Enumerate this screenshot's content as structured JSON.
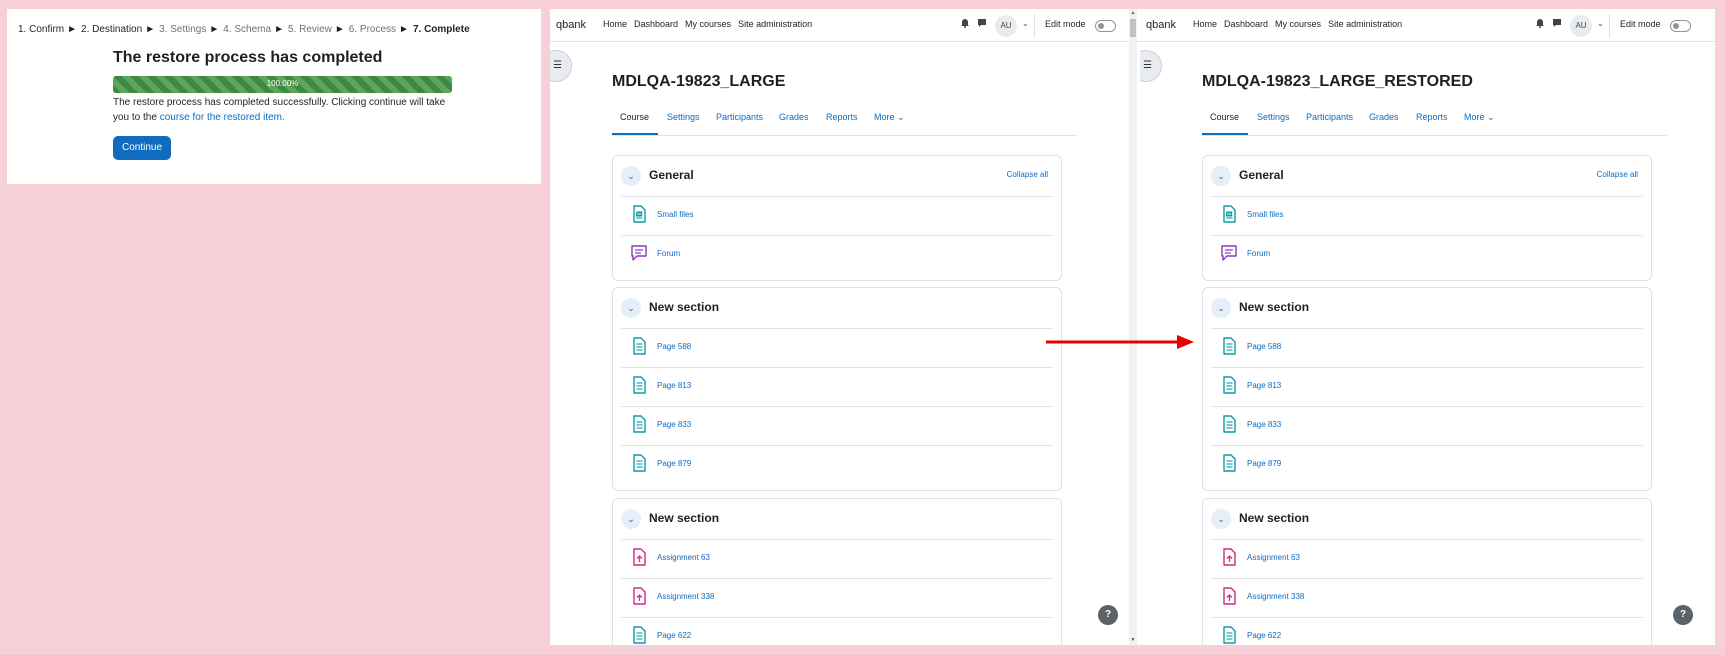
{
  "restore": {
    "steps": [
      {
        "label": "1. Confirm",
        "state": "done"
      },
      {
        "label": "2. Destination",
        "state": "done"
      },
      {
        "label": "3. Settings",
        "state": "todo"
      },
      {
        "label": "4. Schema",
        "state": "todo"
      },
      {
        "label": "5. Review",
        "state": "todo"
      },
      {
        "label": "6. Process",
        "state": "todo"
      },
      {
        "label": "7. Complete",
        "state": "current"
      }
    ],
    "step_separator": "►",
    "heading": "The restore process has completed",
    "progress_value": 1.0,
    "progress_label": "100.00%",
    "message_prefix": "The restore process has completed successfully. Clicking continue will take you to the ",
    "message_link": "course for the restored item.",
    "continue_label": "Continue",
    "colors": {
      "progress": "#3d8a3e",
      "button": "#0f6cbf"
    }
  },
  "navbar": {
    "brand": "qbank",
    "links": [
      "Home",
      "Dashboard",
      "My courses",
      "Site administration"
    ],
    "avatar": "AU",
    "edit_mode_label": "Edit mode",
    "icons": [
      "bell-icon",
      "chat-icon",
      "chevron-down-icon"
    ]
  },
  "windows": [
    {
      "course_title": "MDLQA-19823_LARGE",
      "tabs": [
        "Course",
        "Settings",
        "Participants",
        "Grades",
        "Reports",
        "More ⌄"
      ],
      "collapse_all": "Collapse all",
      "sections": [
        {
          "title": "General",
          "activities": [
            {
              "type": "file",
              "name": "Small files"
            },
            {
              "type": "forum",
              "name": "Forum"
            }
          ]
        },
        {
          "title": "New section",
          "activities": [
            {
              "type": "page",
              "name": "Page 588"
            },
            {
              "type": "page",
              "name": "Page 813"
            },
            {
              "type": "page",
              "name": "Page 833"
            },
            {
              "type": "page",
              "name": "Page 879"
            }
          ]
        },
        {
          "title": "New section",
          "activities": [
            {
              "type": "assign",
              "name": "Assignment 63"
            },
            {
              "type": "assign",
              "name": "Assignment 338"
            },
            {
              "type": "page",
              "name": "Page 622"
            }
          ]
        }
      ]
    },
    {
      "course_title": "MDLQA-19823_LARGE_RESTORED",
      "tabs": [
        "Course",
        "Settings",
        "Participants",
        "Grades",
        "Reports",
        "More ⌄"
      ],
      "collapse_all": "Collapse all",
      "sections": [
        {
          "title": "General",
          "activities": [
            {
              "type": "file",
              "name": "Small files"
            },
            {
              "type": "forum",
              "name": "Forum"
            }
          ]
        },
        {
          "title": "New section",
          "activities": [
            {
              "type": "page",
              "name": "Page 588"
            },
            {
              "type": "page",
              "name": "Page 813"
            },
            {
              "type": "page",
              "name": "Page 833"
            },
            {
              "type": "page",
              "name": "Page 879"
            }
          ]
        },
        {
          "title": "New section",
          "activities": [
            {
              "type": "assign",
              "name": "Assignment 63"
            },
            {
              "type": "assign",
              "name": "Assignment 338"
            },
            {
              "type": "page",
              "name": "Page 622"
            }
          ]
        }
      ]
    }
  ],
  "help_label": "?",
  "colors": {
    "background": "#f7cfd6",
    "link": "#0f6cbf",
    "page_icon": "#0f9aa6",
    "forum_icon": "#8a3ab9",
    "assign_icon": "#d12c7f",
    "arrow": "#e60000"
  }
}
